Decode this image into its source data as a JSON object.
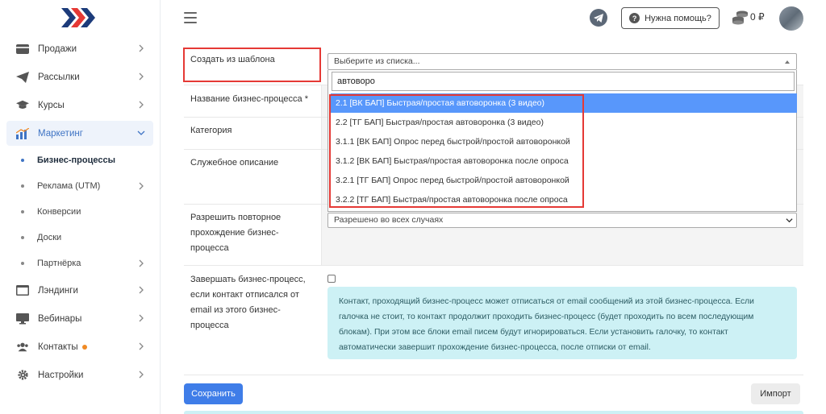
{
  "sidebar": {
    "items": [
      {
        "label": "Продажи",
        "icon": "card-icon"
      },
      {
        "label": "Рассылки",
        "icon": "paper-plane-icon"
      },
      {
        "label": "Курсы",
        "icon": "graduation-cap-icon"
      },
      {
        "label": "Маркетинг",
        "icon": "chart-icon",
        "active": true
      },
      {
        "label": "Лэндинги",
        "icon": "browser-icon"
      },
      {
        "label": "Вебинары",
        "icon": "monitor-icon"
      },
      {
        "label": "Контакты",
        "icon": "users-icon"
      },
      {
        "label": "Настройки",
        "icon": "gear-icon"
      }
    ],
    "sub_items": [
      {
        "label": "Бизнес-процессы",
        "active": true
      },
      {
        "label": "Реклама (UTM)"
      },
      {
        "label": "Конверсии"
      },
      {
        "label": "Доски"
      },
      {
        "label": "Партнёрка"
      }
    ]
  },
  "header": {
    "help_label": "Нужна помощь?",
    "balance": "0 ₽"
  },
  "form": {
    "template_label": "Создать из шаблона",
    "template_placeholder": "Выберите из списка...",
    "search_value": "автоворо",
    "name_label": "Название бизнес-процесса *",
    "category_label": "Категория",
    "description_label": "Служебное описание",
    "repeat_label_1": "Разрешить повторное",
    "repeat_label_2": "прохождение бизнес-",
    "repeat_label_3": "процесса",
    "repeat_value": "Разрешено во всех случаях",
    "finish_label_1": "Завершать бизнес-процесс,",
    "finish_label_2": "если контакт отписался от",
    "finish_label_3": "email из этого бизнес-",
    "finish_label_4": "процесса",
    "info_text": "Контакт, проходящий бизнес-процесс может отписаться от email сообщений из этой бизнес-процесса. Если галочка не стоит, то контакт продолжит проходить бизнес-процесс (будет проходить по всем последующим блокам). При этом все блоки email писем будут игнорироваться. Если установить галочку, то контакт автоматически завершит прохождение бизнес-процесса, после отписки от email.",
    "options": [
      "2.1 [ВК БАП] Быстрая/простая автоворонка (3 видео)",
      "2.2 [ТГ БАП] Быстрая/простая автоворонка (3 видео)",
      "3.1.1 [ВК БАП] Опрос перед быстрой/простой автоворонкой",
      "3.1.2 [ВК БАП] Быстрая/простая автоворонка после опроса",
      "3.2.1 [ТГ БАП] Опрос перед быстрой/простой автоворонкой",
      "3.2.2 [ТГ БАП] Быстрая/простая автоворонка после опроса"
    ],
    "save_label": "Сохранить",
    "import_label": "Импорт"
  },
  "colors": {
    "accent": "#3f7de8",
    "selected_option": "#5897fb",
    "highlight_border": "#e53935",
    "info_bg": "#cdf1f5",
    "notification_dot": "#f08a24"
  }
}
